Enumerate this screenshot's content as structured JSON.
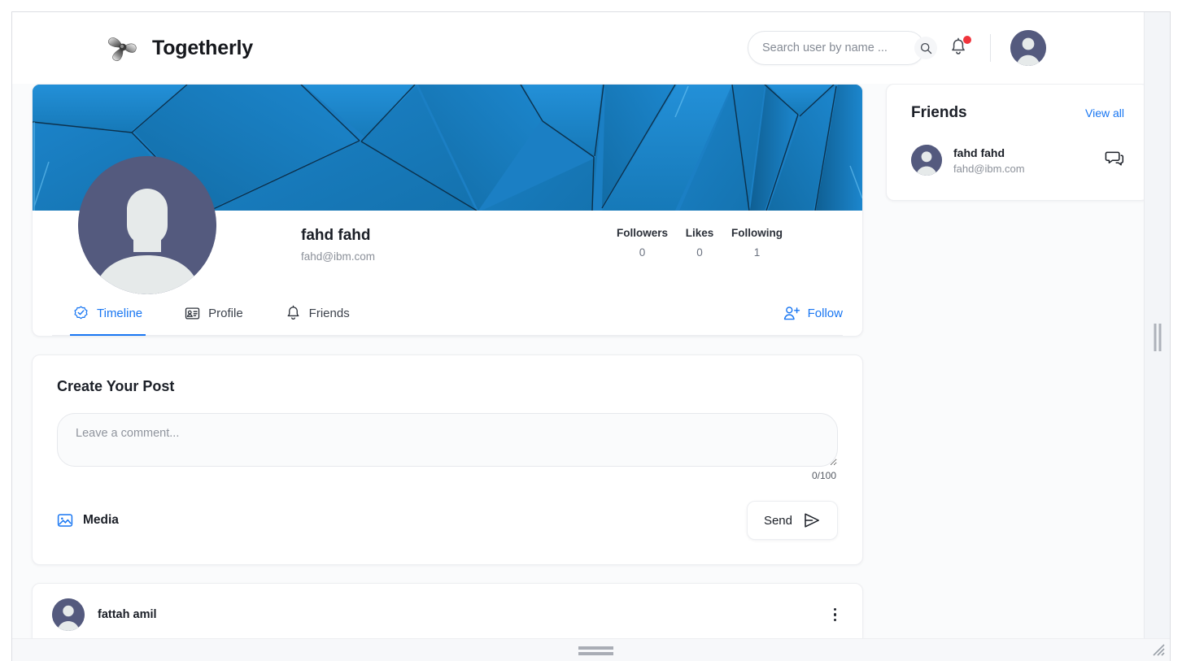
{
  "app": {
    "brand_title": "Togetherly",
    "logo_icon": "pinwheel-logo-icon"
  },
  "header": {
    "search": {
      "placeholder": "Search user by name ...",
      "value": "",
      "icon": "search-icon"
    },
    "notifications": {
      "icon": "bell-icon",
      "has_unread": true,
      "badge_color": "#f0343c"
    },
    "account_avatar": "user-avatar-icon"
  },
  "profile": {
    "cover_image": "blue-polygon-cover",
    "avatar": "default-user-avatar",
    "name": "fahd fahd",
    "email": "fahd@ibm.com",
    "stats": [
      {
        "label": "Followers",
        "value": "0"
      },
      {
        "label": "Likes",
        "value": "0"
      },
      {
        "label": "Following",
        "value": "1"
      }
    ],
    "tabs": [
      {
        "label": "Timeline",
        "icon": "verified-check-icon",
        "active": true
      },
      {
        "label": "Profile",
        "icon": "id-card-icon",
        "active": false
      },
      {
        "label": "Friends",
        "icon": "bell-icon",
        "active": false
      }
    ],
    "follow_button": {
      "label": "Follow",
      "icon": "user-plus-icon"
    }
  },
  "create_post": {
    "title": "Create Your Post",
    "textarea_placeholder": "Leave a comment...",
    "textarea_value": "",
    "char_counter": "0/100",
    "media_button": {
      "label": "Media",
      "icon": "image-icon"
    },
    "send_button": {
      "label": "Send",
      "icon": "send-paper-plane-icon"
    }
  },
  "feed": {
    "posts": [
      {
        "author": "fattah amil",
        "avatar": "default-user-avatar",
        "menu_icon": "more-vertical-icon"
      }
    ]
  },
  "friends_panel": {
    "title": "Friends",
    "view_all_label": "View all",
    "friends": [
      {
        "name": "fahd fahd",
        "email": "fahd@ibm.com",
        "avatar": "default-user-avatar",
        "chat_icon": "chat-bubble-icon"
      }
    ]
  },
  "theme": {
    "accent": "#1876f2",
    "cover_blue": "#1b7fc4",
    "avatar_bg": "#545a7e",
    "badge_red": "#f0343c",
    "page_bg": "#fafbfc"
  }
}
